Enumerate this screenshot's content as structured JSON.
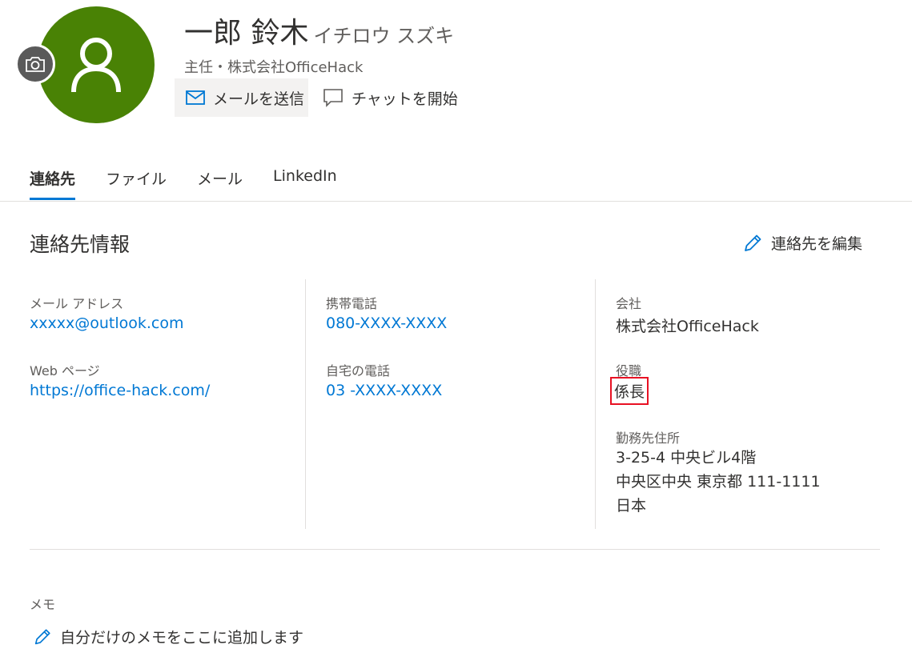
{
  "profile": {
    "name": "一郎 鈴木",
    "name_kana": "イチロウ スズキ",
    "subtitle": "主任・株式会社OfficeHack",
    "avatar_color": "#498205",
    "avatar_icon": "person-icon",
    "camera_icon": "camera-icon"
  },
  "actions": {
    "send_mail": "メールを送信",
    "start_chat": "チャットを開始"
  },
  "tabs": [
    {
      "label": "連絡先",
      "active": true
    },
    {
      "label": "ファイル",
      "active": false
    },
    {
      "label": "メール",
      "active": false
    },
    {
      "label": "LinkedIn",
      "active": false
    }
  ],
  "contact": {
    "section_title": "連絡先情報",
    "edit_label": "連絡先を編集",
    "email_label": "メール アドレス",
    "email": "xxxxx@outlook.com",
    "web_label": "Web ページ",
    "web": "https://office-hack.com/",
    "mobile_label": "携帯電話",
    "mobile": "080-XXXX-XXXX",
    "home_phone_label": "自宅の電話",
    "home_phone": "03 -XXXX-XXXX",
    "company_label": "会社",
    "company": "株式会社OfficeHack",
    "title_label": "役職",
    "title": "係長",
    "address_label": "勤務先住所",
    "address_lines": [
      "3-25-4 中央ビル4階",
      "中央区中央 東京都 111-1111",
      "日本"
    ]
  },
  "memo": {
    "label": "メモ",
    "add_label": "自分だけのメモをここに追加します"
  },
  "colors": {
    "accent": "#0078d4",
    "highlight_border": "#e81123"
  }
}
